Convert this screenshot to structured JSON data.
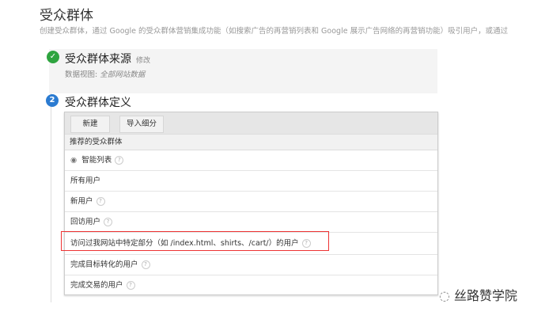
{
  "title": "受众群体",
  "subtitle": "创建受众群体，通过 Google 的受众群体营销集成功能（如搜索广告的再营销列表和 Google 展示广告网络的再营销功能）吸引用户，或通过",
  "step1": {
    "number_icon": "check-icon",
    "title": "受众群体来源",
    "edit": "修改",
    "view_label": "数据视图:",
    "view_value": "全部网站数据"
  },
  "step2": {
    "number": "2",
    "title": "受众群体定义",
    "buttons": {
      "new": "新建",
      "import": "导入细分"
    },
    "header": "推荐的受众群体",
    "rows": [
      {
        "label": "智能列表",
        "help": "?"
      },
      {
        "label": "所有用户"
      },
      {
        "label": "新用户",
        "help": "?"
      },
      {
        "label": "回访用户",
        "help": "?"
      },
      {
        "label": "访问过我网站中特定部分（如 /index.html、shirts、/cart/）的用户",
        "help": "?"
      },
      {
        "label": "完成目标转化的用户",
        "help": "?"
      },
      {
        "label": "完成交易的用户",
        "help": "?"
      }
    ]
  },
  "watermark": "丝路赞学院",
  "colors": {
    "check": "#2ea43f",
    "step": "#2b7bd1",
    "highlight": "#e33333"
  }
}
